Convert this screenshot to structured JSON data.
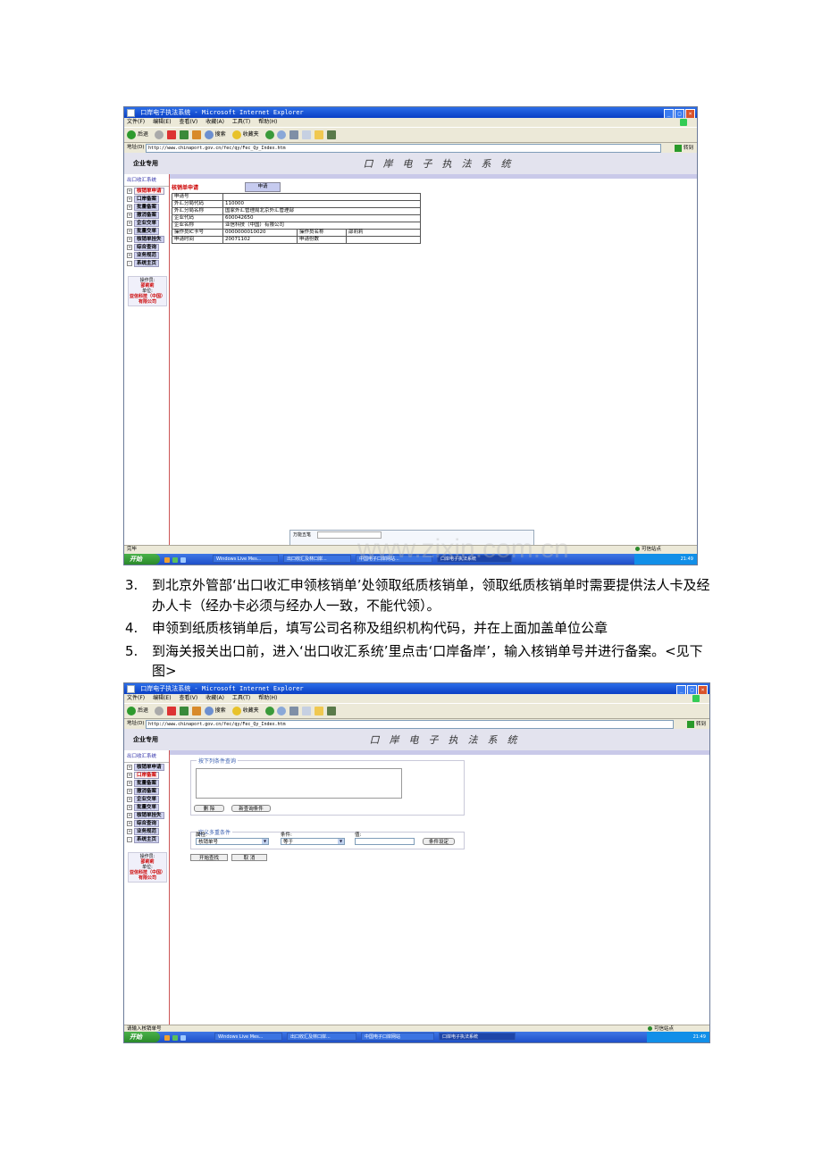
{
  "shot1": {
    "window_title": "口岸电子执法系统 - Microsoft Internet Explorer",
    "menu": [
      "文件(F)",
      "编辑(E)",
      "查看(V)",
      "收藏(A)",
      "工具(T)",
      "帮助(H)"
    ],
    "toolbar": {
      "back": "后退",
      "search": "搜索",
      "favorites": "收藏夹"
    },
    "address_label": "地址(D)",
    "address": "http://www.chinaport.gov.cn/fec/qy/Fec_Qy_Index.htm",
    "go": "转到",
    "banner_left": "企业专用",
    "banner_title": "口岸电子执法系统",
    "sidebar_head": "出口收汇系统",
    "sidebar_items": [
      "核销单申请",
      "口岸备案",
      "批量备案",
      "撤消备案",
      "企业交单",
      "批量交单",
      "核销单挂失",
      "综合查询",
      "业务规范",
      "系统主页"
    ],
    "operator_label": "操作员:",
    "operator": "邵莉莉",
    "unit_label": "单位:",
    "unit": "亚信科技（中国）有限公司",
    "form_title": "核销单申请",
    "apply_button": "申请",
    "table": {
      "r1": {
        "l1": "申请号",
        "v1": ""
      },
      "r2": {
        "l1": "外汇分局代码",
        "v1": "110000"
      },
      "r3": {
        "l1": "外汇分局名称",
        "v1": "国家外汇管理局北京外汇管理部"
      },
      "r4": {
        "l1": "企业代码",
        "v1": "600042650"
      },
      "r5": {
        "l1": "企业名称",
        "v1": "亚信科技（中国）有限公司"
      },
      "r6": {
        "l1": "操作员IC卡号",
        "v1": "0000000010020",
        "l2": "操作员名称",
        "v2": "邵莉莉"
      },
      "r7": {
        "l1": "申请时间",
        "v1": "20071102",
        "l2": "申请份数",
        "v2": ""
      }
    },
    "status": "完毕",
    "zone": "可信站点",
    "popup_tab": "万能五笔",
    "taskbar": {
      "start": "开始",
      "buttons": [
        "Windows Live Mes...",
        "出口收汇及林口岸...",
        "中国电子口岸网站...",
        "口岸电子执法系统"
      ],
      "clock": "21:49"
    }
  },
  "text": {
    "items": [
      {
        "num": "3.",
        "text": "到北京外管部‘出口收汇申领核销单’处领取纸质核销单，领取纸质核销单时需要提供法人卡及经办人卡（经办卡必须与经办人一致，不能代领）。"
      },
      {
        "num": "4.",
        "text": "申领到纸质核销单后，填写公司名称及组织机构代码，并在上面加盖单位公章"
      },
      {
        "num": "5.",
        "text": "到海关报关出口前，进入‘出口收汇系统’里点击‘口岸备岸’，输入核销单号并进行备案。<见下图>"
      }
    ],
    "watermark": "www.zixin.com.cn"
  },
  "shot2": {
    "window_title": "口岸电子执法系统 - Microsoft Internet Explorer",
    "sidebar_items": [
      "核销单申请",
      "口岸备案",
      "批量备案",
      "撤消备案",
      "企业交单",
      "批量交单",
      "核销单挂失",
      "综合查询",
      "业务规范",
      "系统主页"
    ],
    "group1_title": "按下列条件查询",
    "delete_btn": "删 除",
    "new_cond_btn": "新查询条件",
    "group2_title": "定义多重条件",
    "attr_label": "属性:",
    "attr_value": "核销单号",
    "cond_label": "条件:",
    "cond_value": "等于",
    "val_label": "值:",
    "set_cond_btn": "条件设定",
    "start_btn": "开始查找",
    "cancel_btn": "取 消",
    "status": "请输入核销单号",
    "zone": "可信站点",
    "taskbar": {
      "start": "开始",
      "buttons": [
        "Windows Live Mes...",
        "出口收汇及林口岸...",
        "中国电子口岸网站",
        "口岸电子执法系统"
      ],
      "clock": "21:49"
    }
  },
  "colors": {
    "titlebar": "#0a3fc5",
    "accent_red": "#cc0000",
    "sidebar_btn": "#cfd2f0"
  }
}
